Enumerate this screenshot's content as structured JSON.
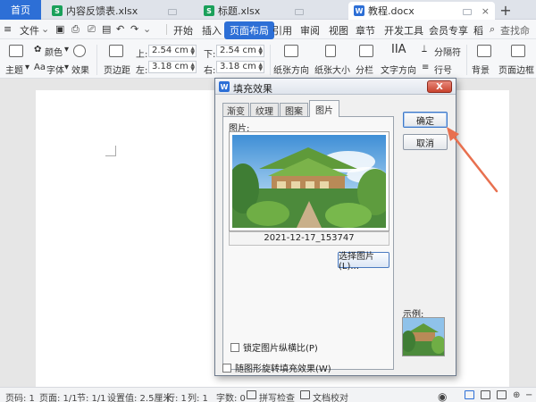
{
  "tabs": {
    "home": "首页",
    "docs": [
      {
        "name": "内容反馈表.xlsx",
        "type": "S"
      },
      {
        "name": "标题.xlsx",
        "type": "S"
      },
      {
        "name": "教程.docx",
        "type": "W"
      }
    ],
    "close": "×",
    "new_tab": "+"
  },
  "menu": {
    "file": "文件",
    "items": [
      "开始",
      "插入",
      "页面布局",
      "引用",
      "审阅",
      "视图",
      "章节",
      "开发工具",
      "会员专享",
      "稻"
    ],
    "active": "页面布局",
    "search": "查找命令"
  },
  "ribbon": {
    "theme": "主题",
    "colors": "颜色",
    "fonts": "字体",
    "effects": "效果",
    "margins": "页边距",
    "top_label": "上:",
    "top_value": "2.54 cm",
    "bottom_label": "下:",
    "bottom_value": "2.54 cm",
    "left_label": "左:",
    "left_value": "3.18 cm",
    "right_label": "右:",
    "right_value": "3.18 cm",
    "orientation": "纸张方向",
    "size": "纸张大小",
    "columns": "分栏",
    "text_direction": "文字方向",
    "separator": "分隔符",
    "line_number": "行号",
    "background": "背景",
    "page_border": "页面边框"
  },
  "dialog": {
    "title": "填充效果",
    "close": "X",
    "tabs": [
      "渐变",
      "纹理",
      "图案",
      "图片"
    ],
    "active_tab": "图片",
    "picture_label": "图片:",
    "filename": "2021-12-17_153747",
    "select_button": "选择图片(L)...",
    "lock_ratio": "锁定图片纵横比(P)",
    "rotate_with_shape": "随图形旋转填充效果(W)",
    "ok": "确定",
    "cancel": "取消",
    "sample": "示例:"
  },
  "status": {
    "page_num": "页码: 1",
    "pages": "页面: 1/1",
    "section": "节: 1/1",
    "setting": "设置值: 2.5厘米",
    "row": "行: 1",
    "col": "列: 1",
    "words": "字数: 0",
    "spell": "拼写检查",
    "proof": "文档校对"
  },
  "colors": {
    "accent": "#2d6fd6",
    "arrow": "#e8704f"
  }
}
